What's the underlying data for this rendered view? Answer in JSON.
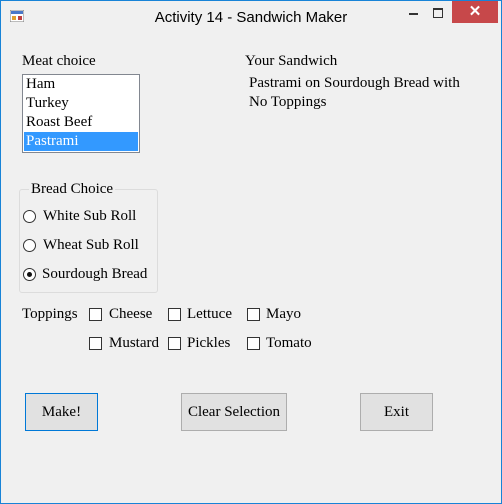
{
  "window": {
    "title": "Activity 14 - Sandwich Maker",
    "close_glyph": "✕"
  },
  "meat": {
    "label": "Meat choice",
    "items": [
      {
        "label": "Ham"
      },
      {
        "label": "Turkey"
      },
      {
        "label": "Roast Beef"
      },
      {
        "label": "Pastrami"
      }
    ],
    "selected": "Pastrami"
  },
  "sandwich": {
    "label": "Your Sandwich",
    "line1": "Pastrami on Sourdough Bread with",
    "line2": "No Toppings"
  },
  "bread": {
    "title": "Bread Choice",
    "options": [
      {
        "label": "White Sub Roll",
        "checked": false
      },
      {
        "label": "Wheat Sub Roll",
        "checked": false
      },
      {
        "label": "Sourdough Bread",
        "checked": true
      }
    ]
  },
  "toppings": {
    "label": "Toppings",
    "items": [
      {
        "label": "Cheese",
        "checked": false
      },
      {
        "label": "Lettuce",
        "checked": false
      },
      {
        "label": "Mayo",
        "checked": false
      },
      {
        "label": "Mustard",
        "checked": false
      },
      {
        "label": "Pickles",
        "checked": false
      },
      {
        "label": "Tomato",
        "checked": false
      }
    ]
  },
  "buttons": {
    "make": "Make!",
    "clear": "Clear Selection",
    "exit": "Exit"
  },
  "colors": {
    "selection": "#3399ff",
    "close_button": "#c7484a",
    "window_border": "#1883d7",
    "focus_border": "#0078d7"
  }
}
